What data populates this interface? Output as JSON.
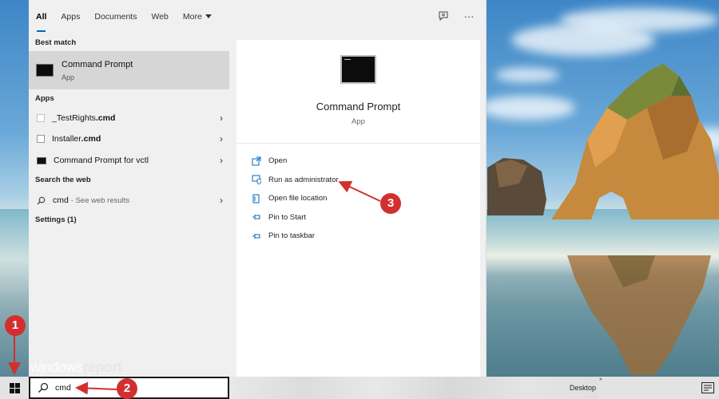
{
  "tabs": {
    "all": "All",
    "apps": "Apps",
    "documents": "Documents",
    "web": "Web",
    "more": "More"
  },
  "tools": {
    "feedback_icon": "feedback-icon",
    "options_icon": "more-options-icon",
    "options_glyph": "···"
  },
  "left": {
    "best_match_heading": "Best match",
    "best_match": {
      "name": "Command Prompt",
      "type": "App"
    },
    "apps_heading": "Apps",
    "apps": [
      {
        "prefix": "_TestRights",
        "suffix": ".cmd"
      },
      {
        "prefix": "Installer",
        "suffix": ".cmd"
      },
      {
        "name": "Command Prompt for vctl"
      }
    ],
    "web_heading": "Search the web",
    "web_item": {
      "query": "cmd",
      "hint": "- See web results"
    },
    "settings_heading": "Settings (1)"
  },
  "right": {
    "title": "Command Prompt",
    "type": "App",
    "actions": [
      {
        "label": "Open",
        "icon": "open-icon"
      },
      {
        "label": "Run as administrator",
        "icon": "shield-admin-icon"
      },
      {
        "label": "Open file location",
        "icon": "folder-location-icon"
      },
      {
        "label": "Pin to Start",
        "icon": "pin-icon"
      },
      {
        "label": "Pin to taskbar",
        "icon": "pin-icon"
      }
    ]
  },
  "taskbar": {
    "search_value": "cmd",
    "desktop_label": "Desktop",
    "chevrons": "»"
  },
  "watermark": {
    "part1": "windows",
    "part2": "report"
  },
  "annotations": {
    "m1": "1",
    "m2": "2",
    "m3": "3",
    "color": "#d32f2f"
  },
  "colors": {
    "accent": "#0067c0",
    "menu_bg": "#f0f0f0",
    "selection": "#d6d6d6"
  }
}
